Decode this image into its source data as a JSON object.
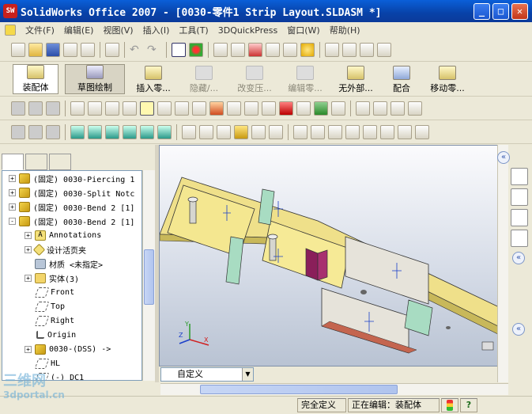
{
  "titlebar": {
    "app_icon": "SW",
    "title": "SolidWorks Office 2007 - [0030-零件1 Strip Layout.SLDASM *]",
    "minimize_glyph": "_",
    "maximize_glyph": "□",
    "close_glyph": "✕"
  },
  "menubar": {
    "items": [
      "文件(F)",
      "编辑(E)",
      "视图(V)",
      "插入(I)",
      "工具(T)",
      "3DQuickPress",
      "窗口(W)",
      "帮助(H)"
    ]
  },
  "command_manager": {
    "buttons": [
      {
        "label": "装配体",
        "enabled": true
      },
      {
        "label": "草图绘制",
        "enabled": true
      },
      {
        "label": "插入零...",
        "enabled": true
      },
      {
        "label": "隐藏/...",
        "enabled": false
      },
      {
        "label": "改变压...",
        "enabled": false
      },
      {
        "label": "编辑零...",
        "enabled": false
      },
      {
        "label": "无外部...",
        "enabled": true
      },
      {
        "label": "配合",
        "enabled": true
      },
      {
        "label": "移动零...",
        "enabled": true
      }
    ]
  },
  "tree": {
    "nodes": [
      {
        "label": "(固定) 0030-Piercing 1",
        "icon": "part",
        "expander": "+"
      },
      {
        "label": "(固定) 0030-Split Notc",
        "icon": "part",
        "expander": "+"
      },
      {
        "label": "(固定) 0030-Bend 2 [1]",
        "icon": "part",
        "expander": "+"
      },
      {
        "label": "(固定) 0030-Bend 2 [1]",
        "icon": "part",
        "expander": "-"
      },
      {
        "label": "Annotations",
        "icon": "annotation",
        "expander": "+"
      },
      {
        "label": "设计活页夹",
        "icon": "binder",
        "expander": "+"
      },
      {
        "label": "材质 <未指定>",
        "icon": "material",
        "expander": ""
      },
      {
        "label": "实体(3)",
        "icon": "folder",
        "expander": "+"
      },
      {
        "label": "Front",
        "icon": "plane",
        "expander": ""
      },
      {
        "label": "Top",
        "icon": "plane",
        "expander": ""
      },
      {
        "label": "Right",
        "icon": "plane",
        "expander": ""
      },
      {
        "label": "Origin",
        "icon": "origin",
        "expander": ""
      },
      {
        "label": "0030-(DSS) ->",
        "icon": "part",
        "expander": "+"
      },
      {
        "label": "HL",
        "icon": "plane",
        "expander": ""
      },
      {
        "label": "(-) DC1",
        "icon": "plane",
        "expander": ""
      }
    ]
  },
  "config": {
    "selected": "自定义"
  },
  "status": {
    "definition": "完全定义",
    "editing": "正在编辑：装配体",
    "help": "?"
  },
  "watermark": {
    "line1": "三维网",
    "line2": "3dportal.cn"
  },
  "colors": {
    "titlebar": "#0842a8",
    "part_face": "#f3e17a",
    "accent_purple": "#8a1f5a",
    "plate_grey": "#d9d6cc",
    "tab_green": "#9fd3b9"
  }
}
